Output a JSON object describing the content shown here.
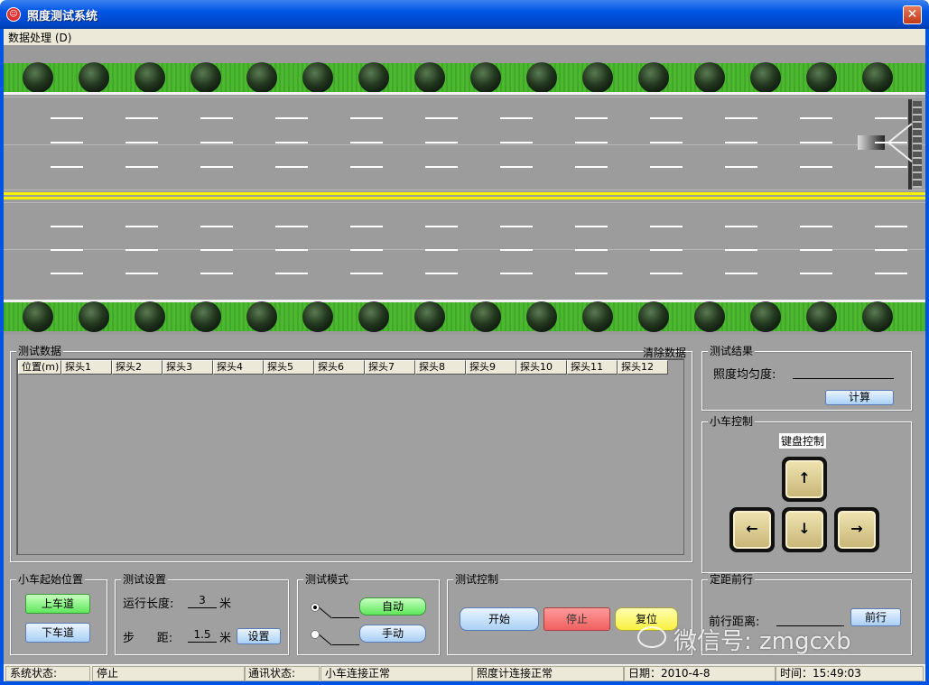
{
  "window": {
    "title": "照度测试系统",
    "close": "✕"
  },
  "menu": {
    "items": [
      "数据处理 (D)"
    ]
  },
  "test_data": {
    "group_label": "测试数据",
    "clear_label": "清除数据",
    "columns": [
      "位置(m)",
      "探头1",
      "探头2",
      "探头3",
      "探头4",
      "探头5",
      "探头6",
      "探头7",
      "探头8",
      "探头9",
      "探头10",
      "探头11",
      "探头12"
    ]
  },
  "test_result": {
    "group_label": "测试结果",
    "uniformity_label": "照度均匀度:",
    "calc_button": "计算"
  },
  "car_control": {
    "group_label": "小车控制",
    "keyboard_label": "键盘控制",
    "up": "↑",
    "left": "←",
    "down": "↓",
    "right": "→"
  },
  "start_position": {
    "group_label": "小车起始位置",
    "up_lane": "上车道",
    "down_lane": "下车道"
  },
  "test_settings": {
    "group_label": "测试设置",
    "length_label": "运行长度:",
    "length_value": "3",
    "length_unit": "米",
    "step_label": "步      距:",
    "step_value": "1.5",
    "step_unit": "米",
    "set_button": "设置"
  },
  "test_mode": {
    "group_label": "测试模式",
    "auto": "自动",
    "manual": "手动",
    "selected": "auto"
  },
  "test_control": {
    "group_label": "测试控制",
    "start": "开始",
    "stop": "停止",
    "reset": "复位"
  },
  "fixed_distance": {
    "group_label": "定距前行",
    "distance_label": "前行距离:",
    "forward_button": "前行"
  },
  "status": {
    "system_label": "系统状态:",
    "system_value": "停止",
    "comm_label": "通讯状态:",
    "car_comm": "小车连接正常",
    "meter_comm": "照度计连接正常",
    "date": "日期：2010-4-8",
    "time": "时间：15:49:03"
  },
  "watermark": "微信号: zmgcxb"
}
